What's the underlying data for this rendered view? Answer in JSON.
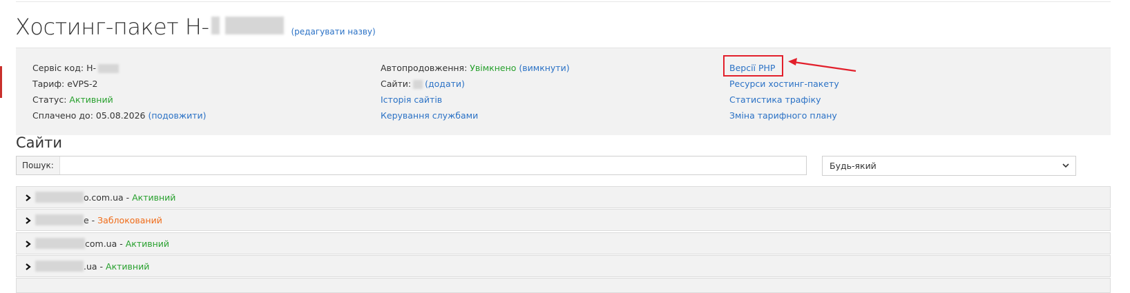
{
  "page": {
    "title_prefix": "Хостинг-пакет H-",
    "rename_link": "(редагувати назву)"
  },
  "info": {
    "service_code_label": "Сервіс код: H-",
    "tariff_label": "Тариф:",
    "tariff_value": "eVPS-2",
    "status_label": "Статус:",
    "status_value": "Активний",
    "paid_until_label": "Сплачено до:",
    "paid_until_value": "05.08.2026",
    "extend_link": "(подовжити)",
    "autorenew_label": "Автопродовження:",
    "autorenew_value": "Увімкнено",
    "autorenew_toggle": "(вимкнути)",
    "sites_label": "Сайти:",
    "sites_add_link": "(додати)",
    "sites_history_link": "Історія сайтів",
    "services_link": "Керування службами",
    "php_versions_link": "Версії PHP",
    "resources_link": "Ресурси хостинг-пакету",
    "traffic_link": "Статистика трафіку",
    "change_plan_link": "Зміна тарифного плану"
  },
  "sites": {
    "title": "Сайти",
    "search_label": "Пошук:",
    "search_value": "",
    "filter_selected": "Будь-який",
    "rows": [
      {
        "suffix": "o.com.ua",
        "sep": " - ",
        "status": "Активний",
        "status_color": "#27a02d"
      },
      {
        "suffix": "e",
        "sep": " - ",
        "status": "Заблокований",
        "status_color": "#f06b17"
      },
      {
        "suffix": "com.ua",
        "sep": " - ",
        "status": "Активний",
        "status_color": "#27a02d"
      },
      {
        "suffix": ".ua",
        "sep": " - ",
        "status": "Активний",
        "status_color": "#27a02d"
      }
    ]
  },
  "colors": {
    "link": "#2a71c5",
    "active_green": "#27a02d",
    "blocked_orange": "#f06b17",
    "annotation_red": "#e21f2b",
    "panel_bg": "#f2f2f2"
  },
  "icons": {
    "row_expand": "chevron-right-icon",
    "select_dropdown": "chevron-down-icon",
    "annotation": "arrow-icon"
  }
}
